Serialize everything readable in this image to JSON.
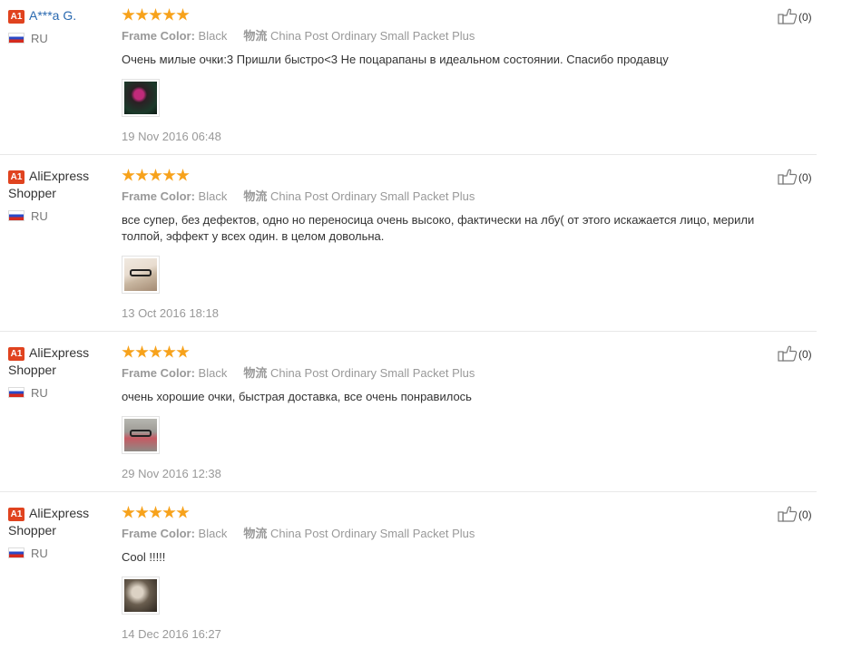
{
  "reviews": [
    {
      "level": "A1",
      "name": "A***a G.",
      "country": "RU",
      "stars": 5,
      "attr_frame_label": "Frame Color:",
      "attr_frame_value": "Black",
      "attr_shipping_label": "物流",
      "attr_shipping_value": "China Post Ordinary Small Packet Plus",
      "text": "Очень милые очки:3 Пришли быстро<3 Не поцарапаны в идеальном состоянии. Спасибо продавцу",
      "date": "19 Nov 2016 06:48",
      "helpful_count": "(0)"
    },
    {
      "level": "A1",
      "name": "AliExpress Shopper",
      "country": "RU",
      "stars": 5,
      "attr_frame_label": "Frame Color:",
      "attr_frame_value": "Black",
      "attr_shipping_label": "物流",
      "attr_shipping_value": "China Post Ordinary Small Packet Plus",
      "text": "все супер, без дефектов, одно но переносица очень высоко, фактически на лбу( от этого искажается лицо, мерили толпой, эффект у всех один. в целом довольна.",
      "date": "13 Oct 2016 18:18",
      "helpful_count": "(0)"
    },
    {
      "level": "A1",
      "name": "AliExpress Shopper",
      "country": "RU",
      "stars": 5,
      "attr_frame_label": "Frame Color:",
      "attr_frame_value": "Black",
      "attr_shipping_label": "物流",
      "attr_shipping_value": "China Post Ordinary Small Packet Plus",
      "text": "очень хорошие очки, быстрая доставка, все очень понравилось",
      "date": "29 Nov 2016 12:38",
      "helpful_count": "(0)"
    },
    {
      "level": "A1",
      "name": "AliExpress Shopper",
      "country": "RU",
      "stars": 5,
      "attr_frame_label": "Frame Color:",
      "attr_frame_value": "Black",
      "attr_shipping_label": "物流",
      "attr_shipping_value": "China Post Ordinary Small Packet Plus",
      "text": "Cool !!!!!",
      "date": "14 Dec 2016 16:27",
      "helpful_count": "(0)"
    }
  ],
  "colors": {
    "star": "#f7a21b",
    "level_badge": "#e0431f",
    "link_name": "#2969b0",
    "muted_text": "#999999"
  },
  "icons": {
    "level": "level-badge",
    "flag": "russia-flag-icon",
    "star": "star-icon",
    "helpful": "thumbs-up-icon"
  }
}
